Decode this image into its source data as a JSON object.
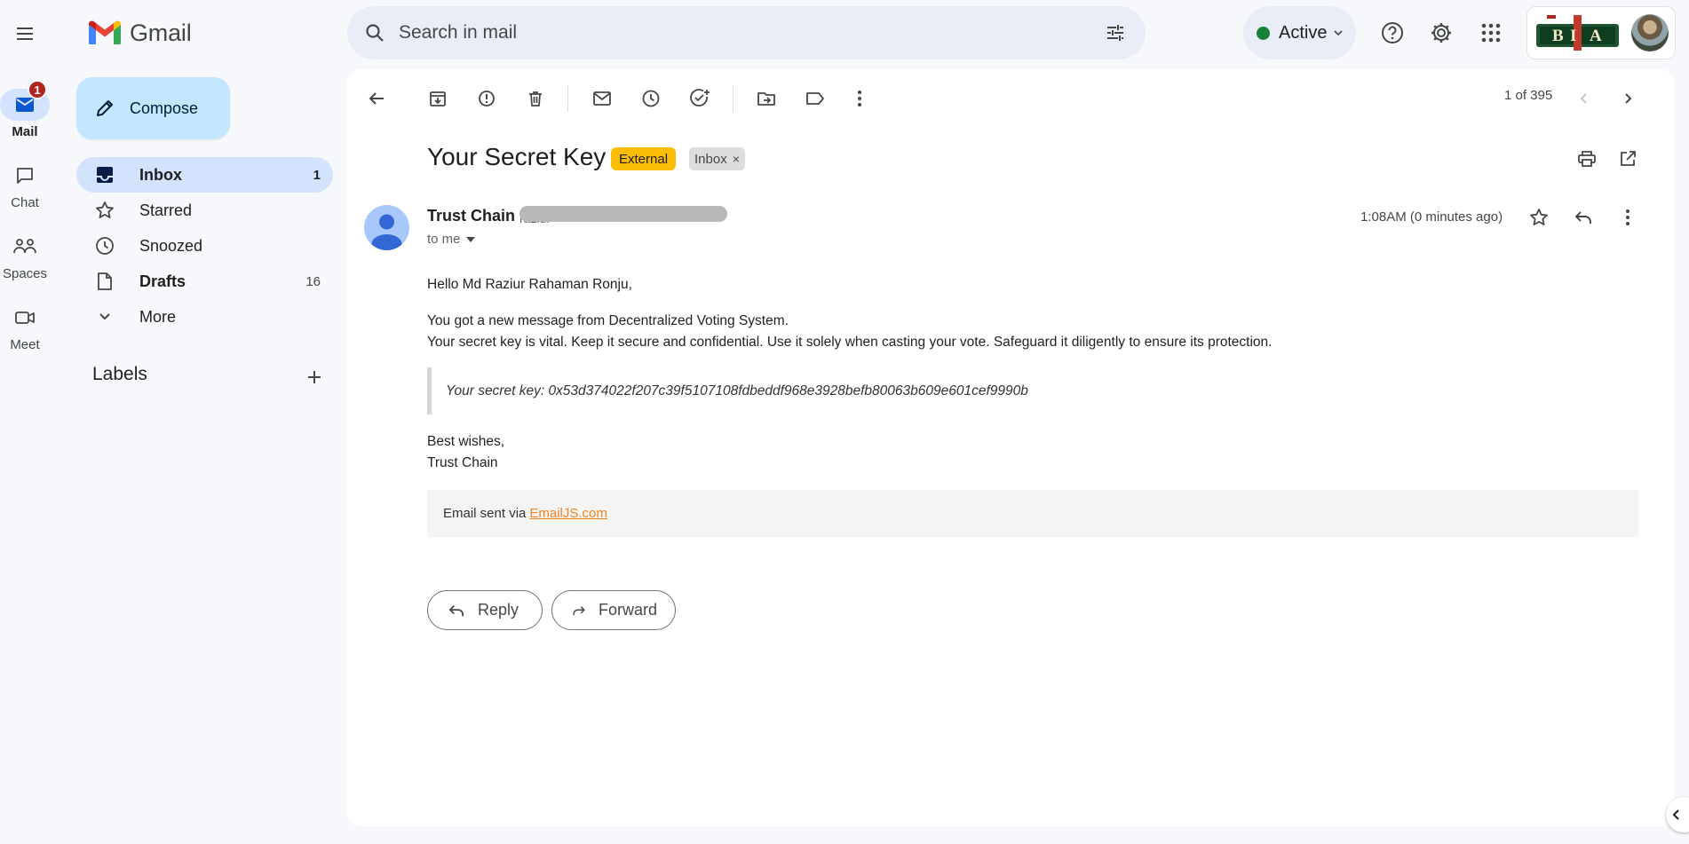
{
  "app": {
    "name": "Gmail"
  },
  "search": {
    "placeholder": "Search in mail"
  },
  "status": {
    "label": "Active",
    "color": "#188038"
  },
  "account": {
    "logo_text": "BIA"
  },
  "rail": [
    {
      "label": "Mail",
      "icon": "mail-icon",
      "badge": "1",
      "active": true
    },
    {
      "label": "Chat",
      "icon": "chat-icon"
    },
    {
      "label": "Spaces",
      "icon": "spaces-icon"
    },
    {
      "label": "Meet",
      "icon": "meet-icon"
    }
  ],
  "nav": {
    "compose_label": "Compose",
    "items": [
      {
        "label": "Inbox",
        "count": "1",
        "icon": "inbox-icon",
        "active": true
      },
      {
        "label": "Starred",
        "count": "",
        "icon": "star-icon"
      },
      {
        "label": "Snoozed",
        "count": "",
        "icon": "clock-icon"
      },
      {
        "label": "Drafts",
        "count": "16",
        "icon": "draft-icon"
      },
      {
        "label": "More",
        "count": "",
        "icon": "chevron-down-icon"
      }
    ],
    "labels_title": "Labels"
  },
  "toolbar": {
    "pager": "1 of 395",
    "icons": [
      "back-arrow-icon",
      "archive-icon",
      "report-spam-icon",
      "delete-icon",
      "mark-unread-icon",
      "snooze-icon",
      "add-task-icon",
      "move-to-icon",
      "label-icon",
      "more-vert-icon"
    ]
  },
  "message": {
    "subject": "Your Secret Key",
    "tags": {
      "external": "External",
      "inbox": "Inbox",
      "inbox_close": "×"
    },
    "sender_name": "Trust Chain",
    "sender_email_partial": "raziur",
    "to": "to me",
    "time": "1:08AM (0 minutes ago)",
    "greeting": "Hello Md Raziur Rahaman Ronju,",
    "line1": "You got a new message from Decentralized Voting System.",
    "line2": "Your secret key is vital. Keep it secure and confidential. Use it solely when casting your vote. Safeguard it diligently to ensure its protection.",
    "quote": "Your secret key: 0x53d374022f207c39f5107108fdbeddf968e3928befb80063b609e601cef9990b",
    "signoff1": "Best wishes,",
    "signoff2": "Trust Chain",
    "footer_prefix": "Email sent via",
    "footer_link": "EmailJS.com",
    "footer_link_color": "#f58220"
  },
  "actions": {
    "reply": "Reply",
    "forward": "Forward"
  }
}
